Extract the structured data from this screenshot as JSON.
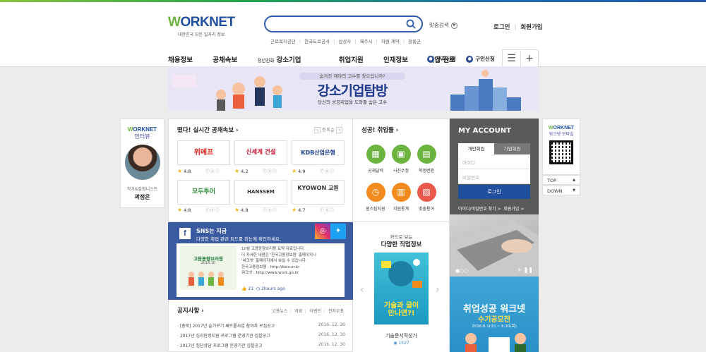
{
  "header": {
    "logo_text": "ORKNET",
    "logo_w": "W",
    "logo_sub": "대한민국 모든 일자리 정보",
    "search_placeholder": "",
    "advanced_search": "맞춤검색",
    "keywords": [
      "근로복지공단",
      "한국도로공사",
      "삼상사",
      "제주시",
      "하원 계약",
      "장릉군"
    ],
    "login": "로그인",
    "join": "회원가입"
  },
  "gnb": {
    "items": [
      "채용정보",
      "공채속보"
    ],
    "small_prefix": "청년친화",
    "items2": [
      "강소기업",
      "취업지원",
      "인재정보",
      "직업·진로"
    ],
    "right_items": [
      "구직신청",
      "구인신청"
    ]
  },
  "banner": {
    "question": "숨겨진 재야의 고수를 찾으십니까?",
    "title": "강소기업탐방",
    "subtitle": "당신의 성공취업을 도와줄 숨은 고수"
  },
  "interview": {
    "logo_text": "ORKNET",
    "logo_w": "W",
    "label": "인터뷰",
    "role": "작가&칼럼니스트",
    "name": "곽정은"
  },
  "live_openings": {
    "title": "떴다! 실시간 공채속보",
    "register": "등록순",
    "companies": [
      {
        "name": "위메프",
        "rating": "4.8",
        "color": "#e2231a"
      },
      {
        "name": "신세계 건설",
        "rating": "4.2",
        "color": "#c8102e"
      },
      {
        "name": "KDB산업은행",
        "rating": "4.9",
        "color": "#1b3f8f"
      },
      {
        "name": "모두투어",
        "rating": "4.8",
        "color": "#2e8b3a"
      },
      {
        "name": "HANSSEM",
        "rating": "4.8",
        "color": "#222222"
      },
      {
        "name": "KYOWON 교원",
        "rating": "4.7",
        "color": "#222222"
      }
    ]
  },
  "success_tools": {
    "title": "성공! 취업툴",
    "items": [
      {
        "label": "공채달력",
        "icon": "calendar-icon",
        "color": "#6db33f"
      },
      {
        "label": "사진수정",
        "icon": "photo-icon",
        "color": "#6db33f"
      },
      {
        "label": "학점변환",
        "icon": "calculator-icon",
        "color": "#6db33f"
      },
      {
        "label": "원스탑지원",
        "icon": "clock-icon",
        "color": "#f28b1d"
      },
      {
        "label": "지원통계",
        "icon": "chart-icon",
        "color": "#f28b1d"
      },
      {
        "label": "맞춤용어",
        "icon": "book-icon",
        "color": "#e8584b"
      }
    ]
  },
  "account": {
    "title": "MY ACCOUNT",
    "tab_personal": "개인회원",
    "tab_company": "기업회원",
    "id_placeholder": "아이디",
    "pw_placeholder": "비밀번호",
    "login_button": "로그인",
    "find": "아이디/비밀번호 찾기 >",
    "join": "회원가입 >"
  },
  "mobile": {
    "logo_text": "ORKNET",
    "logo_w": "W",
    "label": "워크넷 모바일",
    "top": "TOP",
    "down": "DOWN"
  },
  "sns": {
    "title": "SNS는 지금",
    "subtitle": "다양한 취업 관련 피드를 한눈에 확인하세요.",
    "thumb_title": "고용동향브리핑",
    "thumb_date": "2016.10",
    "post_lines": [
      "10월 고용동향브리핑 요약 자료입니다.",
      "더 자세한 내용은 '한국고용정보원' 홈페이지나",
      "'워크넷' 홈페이지에서 보실 수 있습니다.",
      "한국고용정보원 : http://keis.or.kr",
      "워크넷 : http://www.work.go.kr"
    ],
    "likes": "21",
    "time": "2hours ago"
  },
  "notice": {
    "title": "공지사항",
    "tabs": [
      "고용뉴스",
      "자료",
      "이벤트",
      "전자우표"
    ],
    "rows": [
      {
        "text": "· [충북] 2017년 슬기꾸기 패트롤사업 참여자 모집공고",
        "date": "2016. 12. 30"
      },
      {
        "text": "· 2017년 심리안정지원 프로그램 운영기관 입찰공고",
        "date": "2016. 12. 30"
      },
      {
        "text": "· 2017년 집단상담 프로그램 운영기관 입찰공고",
        "date": "2016. 12. 30"
      }
    ]
  },
  "cardnews": {
    "kicker": "카드로 보는",
    "title": "다양한 직업정보",
    "image_title_1": "기술과 글이",
    "image_title_2": "만나면?!",
    "caption": "기술문서작성가",
    "views": "1527"
  },
  "promo": {
    "title": "취업성공 워크넷",
    "subtitle": "수기공모전",
    "date": "2016.6.1(수) ~ 6.30(목)"
  }
}
